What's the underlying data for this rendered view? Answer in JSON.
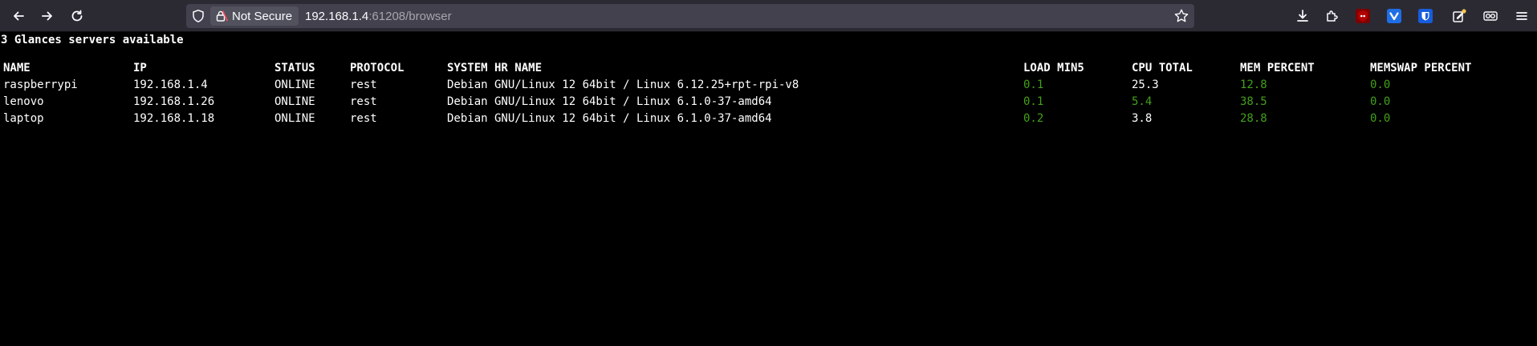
{
  "browser": {
    "security_label": "Not Secure",
    "url_host": "192.168.1.4",
    "url_rest": ":61208/browser",
    "colors": {
      "toolbar": "#2b2a33",
      "urlbar": "#42414d",
      "ublock": "#800000",
      "vpn": "#1e6ee6",
      "bitwarden": "#175ddc"
    }
  },
  "page": {
    "summary": "3 Glances servers available",
    "headers": {
      "name": "NAME",
      "ip": "IP",
      "status": "STATUS",
      "protocol": "PROTOCOL",
      "system": "SYSTEM HR NAME",
      "load": "LOAD MIN5",
      "cpu": "CPU TOTAL",
      "mem": "MEM PERCENT",
      "swap": "MEMSWAP PERCENT"
    },
    "servers": [
      {
        "name": "raspberrypi",
        "ip": "192.168.1.4",
        "status": "ONLINE",
        "protocol": "rest",
        "system": "Debian GNU/Linux 12 64bit / Linux 6.12.25+rpt-rpi-v8",
        "load": "0.1",
        "cpu": "25.3",
        "mem": "12.8",
        "swap": "0.0"
      },
      {
        "name": "lenovo",
        "ip": "192.168.1.26",
        "status": "ONLINE",
        "protocol": "rest",
        "system": "Debian GNU/Linux 12 64bit / Linux 6.1.0-37-amd64",
        "load": "0.1",
        "cpu": "5.4",
        "mem": "38.5",
        "swap": "0.0"
      },
      {
        "name": "laptop",
        "ip": "192.168.1.18",
        "status": "ONLINE",
        "protocol": "rest",
        "system": "Debian GNU/Linux 12 64bit / Linux 6.1.0-37-amd64",
        "load": "0.2",
        "cpu": "3.8",
        "mem": "28.8",
        "swap": "0.0"
      }
    ],
    "colors": {
      "ok": "#43a019",
      "default": "#ffffff",
      "background": "#000000"
    }
  }
}
